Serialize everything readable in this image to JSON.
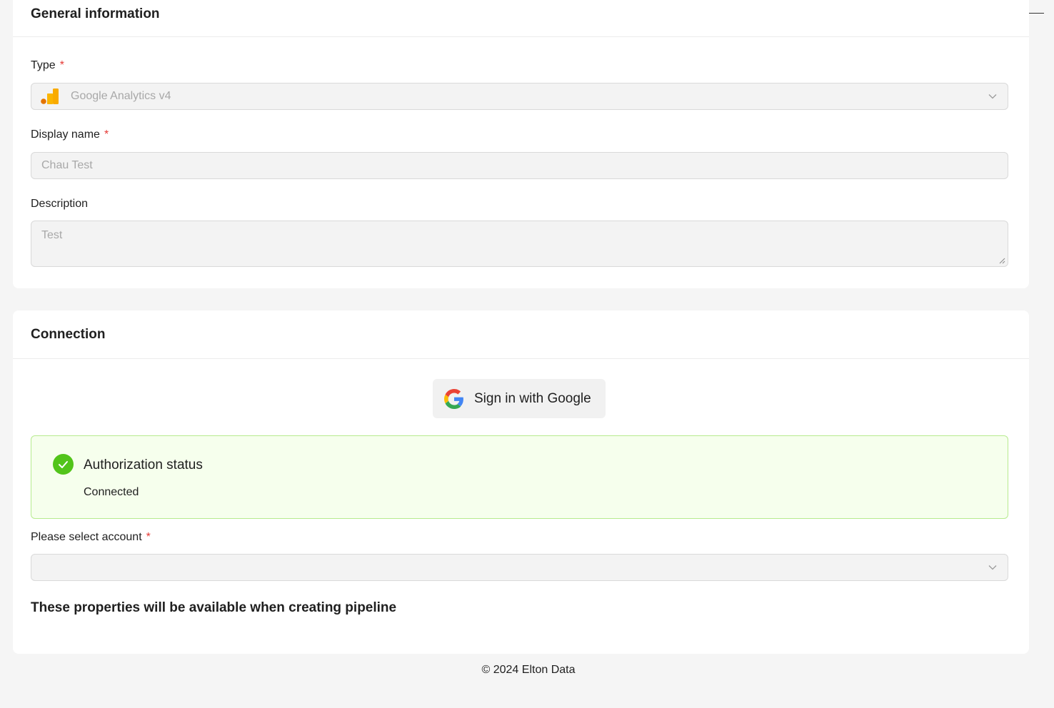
{
  "general": {
    "title": "General information",
    "type_label": "Type",
    "type_value": "Google Analytics v4",
    "type_icon": "google-analytics-icon",
    "display_name_label": "Display name",
    "display_name_value": "Chau Test",
    "description_label": "Description",
    "description_value": "Test",
    "required_mark": "*"
  },
  "connection": {
    "title": "Connection",
    "google_button_label": "Sign in with Google",
    "google_icon": "google-g-icon",
    "auth_status_title": "Authorization status",
    "auth_status_value": "Connected",
    "auth_icon": "check-circle-icon",
    "account_label": "Please select account",
    "account_value": "",
    "properties_note": "These properties will be available when creating pipeline"
  },
  "footer": {
    "copyright": "© 2024 Elton Data"
  },
  "colors": {
    "required": "#e53935",
    "success_bg": "#f6ffed",
    "success_border": "#b7eb8f",
    "success_icon": "#52c41a",
    "ga_orange": "#f9ab00",
    "ga_dark_orange": "#e37400"
  }
}
